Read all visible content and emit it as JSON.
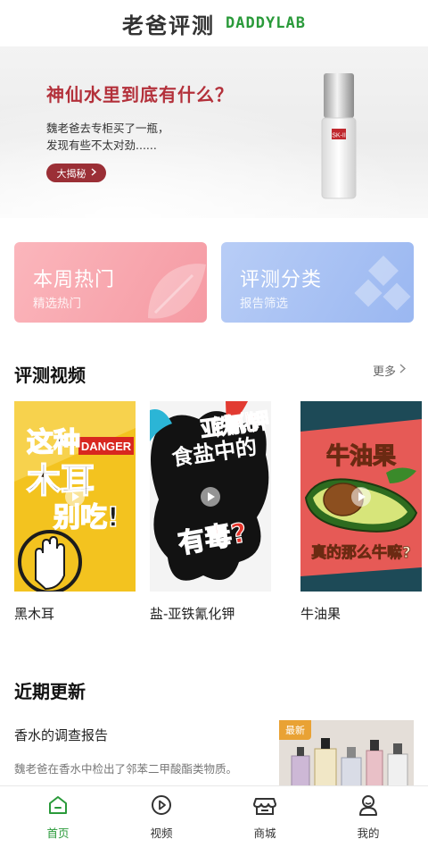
{
  "header": {
    "title_cn": "老爸评测",
    "title_en": "DADDYLAB"
  },
  "banner": {
    "title": "神仙水里到底有什么？",
    "description": "魏老爸去专柜买了一瓶，\n发现有些不太对劲......",
    "button_label": "大揭秘",
    "button_icon": "chevron-right-icon",
    "product_logo": "SK-II"
  },
  "quick_cards": [
    {
      "title": "本周热门",
      "subtitle": "精选热门",
      "color": "#f7a3ab"
    },
    {
      "title": "评测分类",
      "subtitle": "报告筛选",
      "color": "#a6bff3"
    }
  ],
  "videos_section": {
    "title": "评测视频",
    "more_label": "更多",
    "items": [
      {
        "caption": "黑木耳",
        "poster_lines": [
          "这种",
          "木耳",
          "别吃!"
        ],
        "poster_badge": "DANGER"
      },
      {
        "caption": "盐-亚铁氰化钾",
        "poster_lines": [
          "亚铁氰化钾",
          "食盐中的",
          "有毒?"
        ]
      },
      {
        "caption": "牛油果",
        "poster_lines": [
          "牛油果",
          "真的那么牛嘛?"
        ]
      }
    ]
  },
  "updates_section": {
    "title": "近期更新",
    "items": [
      {
        "title": "香水的调查报告",
        "description": "魏老爸在香水中检出了邻苯二甲酸酯类物质。",
        "badge": "最新"
      }
    ]
  },
  "tabbar": {
    "items": [
      {
        "label": "首页",
        "icon": "home-icon",
        "active": true
      },
      {
        "label": "视频",
        "icon": "play-circle-icon",
        "active": false
      },
      {
        "label": "商城",
        "icon": "store-icon",
        "active": false
      },
      {
        "label": "我的",
        "icon": "user-icon",
        "active": false
      }
    ]
  },
  "colors": {
    "accent": "#2a9a3a",
    "banner_title": "#b3303a",
    "badge": "#e9a234"
  }
}
